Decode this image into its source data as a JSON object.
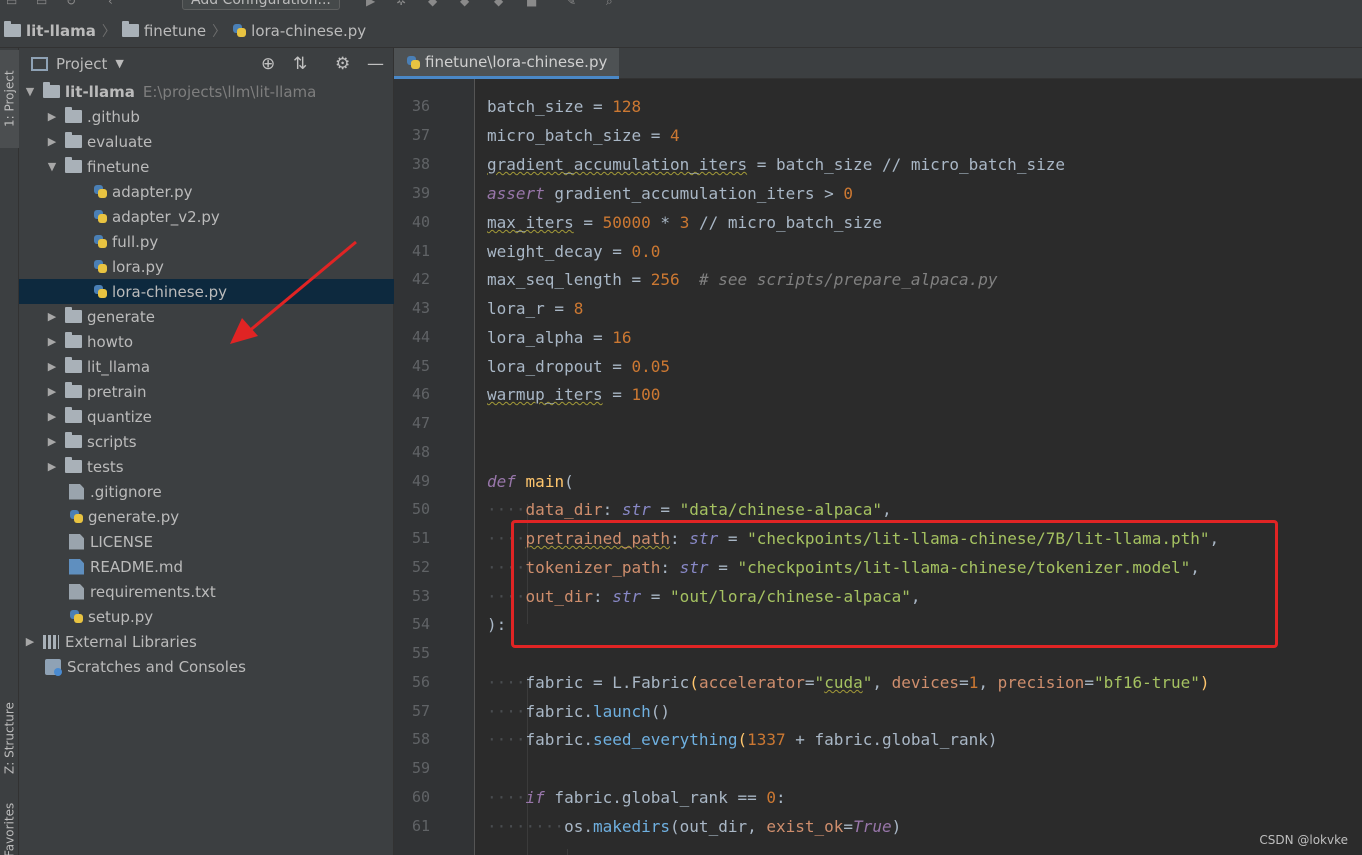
{
  "toolbar": {
    "config_label": "Add Configuration..."
  },
  "navbar": {
    "crumbs": [
      "lit-llama",
      "finetune",
      "lora-chinese.py"
    ]
  },
  "left_strip": {
    "project_tab": "1: Project",
    "structure_tab": "Z: Structure",
    "favorites_tab": "Favorites"
  },
  "project_panel": {
    "title": "Project",
    "root": {
      "name": "lit-llama",
      "path": "E:\\projects\\llm\\lit-llama"
    },
    "items": [
      {
        "name": ".github",
        "type": "folder"
      },
      {
        "name": "evaluate",
        "type": "folder"
      },
      {
        "name": "finetune",
        "type": "folder-open"
      },
      {
        "name": "adapter.py",
        "type": "python"
      },
      {
        "name": "adapter_v2.py",
        "type": "python"
      },
      {
        "name": "full.py",
        "type": "python"
      },
      {
        "name": "lora.py",
        "type": "python"
      },
      {
        "name": "lora-chinese.py",
        "type": "python",
        "selected": true
      },
      {
        "name": "generate",
        "type": "folder"
      },
      {
        "name": "howto",
        "type": "folder"
      },
      {
        "name": "lit_llama",
        "type": "folder"
      },
      {
        "name": "pretrain",
        "type": "folder"
      },
      {
        "name": "quantize",
        "type": "folder"
      },
      {
        "name": "scripts",
        "type": "folder"
      },
      {
        "name": "tests",
        "type": "folder"
      },
      {
        "name": ".gitignore",
        "type": "git"
      },
      {
        "name": "generate.py",
        "type": "python"
      },
      {
        "name": "LICENSE",
        "type": "text"
      },
      {
        "name": "README.md",
        "type": "markdown"
      },
      {
        "name": "requirements.txt",
        "type": "text"
      },
      {
        "name": "setup.py",
        "type": "python"
      },
      {
        "name": "External Libraries",
        "type": "library"
      },
      {
        "name": "Scratches and Consoles",
        "type": "scratch"
      }
    ]
  },
  "editor": {
    "tab_label": "finetune\\lora-chinese.py",
    "line_numbers": [
      "36",
      "37",
      "38",
      "39",
      "40",
      "41",
      "42",
      "43",
      "44",
      "45",
      "46",
      "47",
      "48",
      "49",
      "50",
      "51",
      "52",
      "53",
      "54",
      "55",
      "56",
      "57",
      "58",
      "59",
      "60",
      "61"
    ]
  },
  "code": {
    "l36": {
      "name": "batch_size",
      "eq": " = ",
      "val": "128"
    },
    "l37": {
      "name": "micro_batch_size",
      "eq": " = ",
      "val": "4"
    },
    "l38": {
      "name": "gradient_accumulation_iters",
      "rest": " = batch_size // micro_batch_size"
    },
    "l39": {
      "kw": "assert",
      "rest": " gradient_accumulation_iters > ",
      "val": "0"
    },
    "l40": {
      "name": "max_iters",
      "eq": " = ",
      "v1": "50000",
      "mid": " * ",
      "v2": "3",
      "rest": " // micro_batch_size"
    },
    "l41": {
      "name": "weight_decay",
      "eq": " = ",
      "val": "0.0"
    },
    "l42": {
      "name": "max_seq_length",
      "eq": " = ",
      "val": "256",
      "cmt": "  # see scripts/prepare_alpaca.py"
    },
    "l43": {
      "name": "lora_r",
      "eq": " = ",
      "val": "8"
    },
    "l44": {
      "name": "lora_alpha",
      "eq": " = ",
      "val": "16"
    },
    "l45": {
      "name": "lora_dropout",
      "eq": " = ",
      "val": "0.05"
    },
    "l46": {
      "name": "warmup_iters",
      "eq": " = ",
      "val": "100"
    },
    "l49": {
      "kw": "def",
      "fn": "main",
      "rest": "("
    },
    "l50": {
      "param": "data_dir",
      "colon": ": ",
      "typ": "str",
      "eq": " = ",
      "str": "\"data/chinese-alpaca\"",
      "end": ","
    },
    "l51": {
      "param": "pretrained_path",
      "colon": ": ",
      "typ": "str",
      "eq": " = ",
      "str": "\"checkpoints/lit-llama-chinese/7B/lit-llama.pth\"",
      "end": ","
    },
    "l52": {
      "param": "tokenizer_path",
      "colon": ": ",
      "typ": "str",
      "eq": " = ",
      "str": "\"checkpoints/lit-llama-chinese/tokenizer.model\"",
      "end": ","
    },
    "l53": {
      "param": "out_dir",
      "colon": ": ",
      "typ": "str",
      "eq": " = ",
      "str": "\"out/lora/chinese-alpaca\"",
      "end": ","
    },
    "l54": {
      "text": "):"
    },
    "l56": {
      "a": "fabric = L.",
      "b": "Fabric",
      "c": "(",
      "p1": "accelerator",
      "e1": "=",
      "s1": "\"",
      "s1m": "cuda",
      "s1e": "\"",
      "d": ", ",
      "p2": "devices",
      "e2": "=",
      "n2": "1",
      "d2": ", ",
      "p3": "precision",
      "e3": "=",
      "s3": "\"bf16-true\"",
      "z": ")"
    },
    "l57": {
      "a": "fabric.",
      "b": "launch",
      "c": "()"
    },
    "l58": {
      "a": "fabric.",
      "b": "seed_everything",
      "c": "(",
      "n": "1337",
      "rest": " + fabric.global_rank)"
    },
    "l60": {
      "kw": "if",
      "rest": " fabric.global_rank == ",
      "val": "0",
      "end": ":"
    },
    "l61": {
      "a": "os.",
      "b": "makedirs",
      "c": "(out_dir, ",
      "p": "exist_ok",
      "e": "=",
      "k": "True",
      "z": ")"
    }
  },
  "watermark": "CSDN @lokvke"
}
